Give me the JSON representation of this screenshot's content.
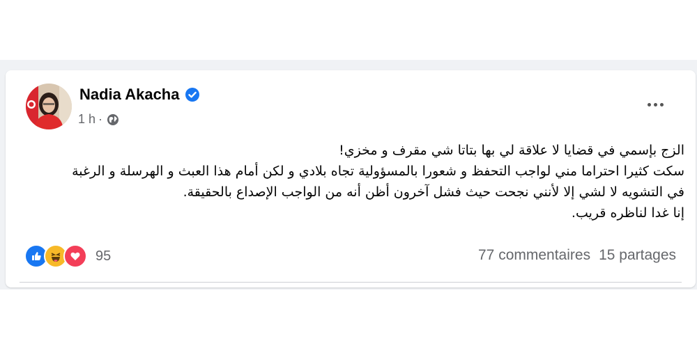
{
  "post": {
    "author": "Nadia Akacha",
    "time": "1 h",
    "separator": "·",
    "text_lines": [
      "الزج بإسمي في قضايا لا علاقة لي بها بتاتا شي مقرف و مخزي!",
      "سكت كثيرا احتراما مني لواجب التحفظ و شعورا بالمسؤولية تجاه بلادي و لكن أمام هذا العبث و الهرسلة و الرغبة",
      "في التشويه لا لشي إلا لأنني نجحت حيث فشل آخرون أظن  أنه من الواجب الإصداع بالحقيقة.",
      "إنا غدا لناظره قريب."
    ],
    "reaction_count": "95",
    "comments": "77 commentaires",
    "shares": "15 partages"
  },
  "icons": {
    "verified": "verified-badge-icon",
    "audience": "globe-icon",
    "more": "more-options-icon",
    "reactions": [
      "like-icon",
      "haha-icon",
      "love-icon"
    ]
  },
  "colors": {
    "facebook_blue": "#1877f2",
    "love_red": "#f33e58",
    "haha_yellow": "#f7b928",
    "secondary_text": "#65676b"
  }
}
